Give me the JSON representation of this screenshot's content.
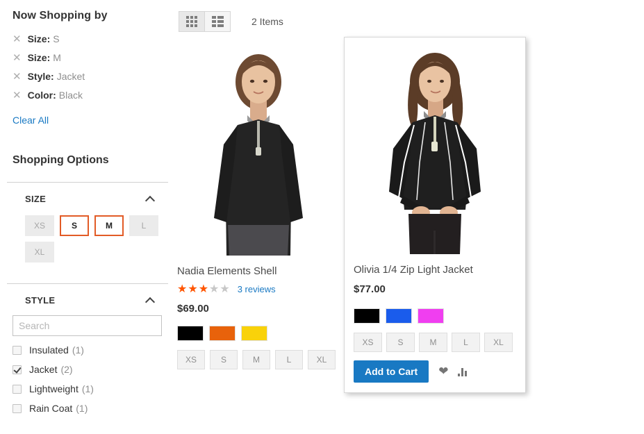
{
  "sidebar": {
    "now_shopping_title": "Now Shopping by",
    "active_filters": [
      {
        "label": "Size:",
        "value": "S",
        "remove_icon": "close-icon"
      },
      {
        "label": "Size:",
        "value": "M",
        "remove_icon": "close-icon"
      },
      {
        "label": "Style:",
        "value": "Jacket",
        "remove_icon": "close-icon"
      },
      {
        "label": "Color:",
        "value": "Black",
        "remove_icon": "close-icon"
      }
    ],
    "clear_all_label": "Clear All",
    "shopping_options_title": "Shopping Options",
    "size_filter": {
      "title": "SIZE",
      "collapse_icon": "chevron-up-icon",
      "options": [
        {
          "label": "XS",
          "selected": false
        },
        {
          "label": "S",
          "selected": true
        },
        {
          "label": "M",
          "selected": true
        },
        {
          "label": "L",
          "selected": false
        },
        {
          "label": "XL",
          "selected": false
        }
      ]
    },
    "style_filter": {
      "title": "STYLE",
      "collapse_icon": "chevron-up-icon",
      "search_placeholder": "Search",
      "search_value": "",
      "options": [
        {
          "label": "Insulated",
          "count": "(1)",
          "checked": false
        },
        {
          "label": "Jacket",
          "count": "(2)",
          "checked": true
        },
        {
          "label": "Lightweight",
          "count": "(1)",
          "checked": false
        },
        {
          "label": "Rain Coat",
          "count": "(1)",
          "checked": false
        }
      ]
    }
  },
  "toolbar": {
    "grid_mode_icon": "grid-view-icon",
    "list_mode_icon": "list-view-icon",
    "active_mode": "grid",
    "items_count_label": "2 Items"
  },
  "products": [
    {
      "name": "Nadia Elements Shell",
      "price": "$69.00",
      "has_rating": true,
      "rating_filled": 3,
      "rating_total": 5,
      "reviews_label": "3 reviews",
      "colors": [
        {
          "name": "Black",
          "hex": "#000000"
        },
        {
          "name": "Orange",
          "hex": "#e8620b"
        },
        {
          "name": "Yellow",
          "hex": "#f9d20a"
        }
      ],
      "sizes": [
        "XS",
        "S",
        "M",
        "L",
        "XL"
      ],
      "hovered": false
    },
    {
      "name": "Olivia 1/4 Zip Light Jacket",
      "price": "$77.00",
      "has_rating": false,
      "colors": [
        {
          "name": "Black",
          "hex": "#000000"
        },
        {
          "name": "Blue",
          "hex": "#1a5cec"
        },
        {
          "name": "Magenta",
          "hex": "#f03ef0"
        }
      ],
      "sizes": [
        "XS",
        "S",
        "M",
        "L",
        "XL"
      ],
      "hovered": true,
      "add_to_cart_label": "Add to Cart",
      "wishlist_icon": "heart-icon",
      "compare_icon": "compare-bars-icon"
    }
  ],
  "theme": {
    "accent_blue": "#1979c3",
    "accent_orange": "#e25b26",
    "star_orange": "#ff5501"
  }
}
